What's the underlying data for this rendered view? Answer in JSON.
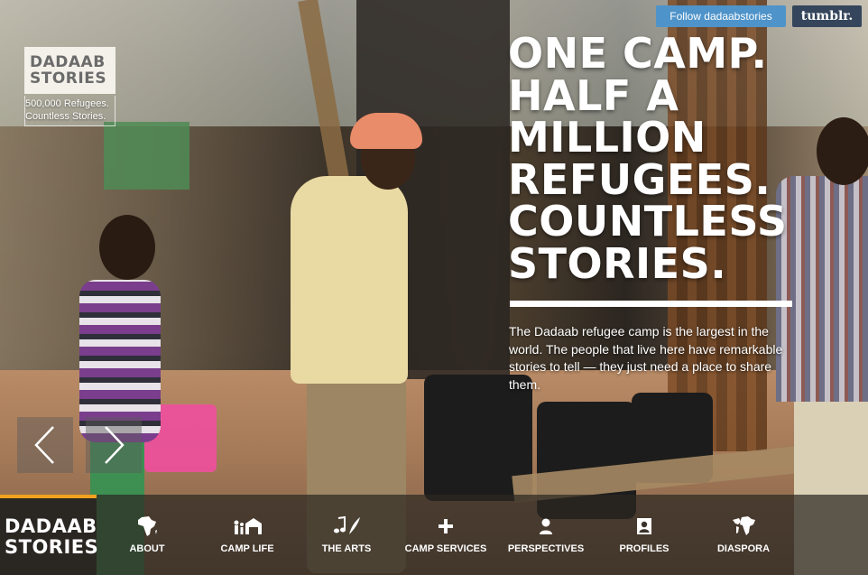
{
  "brand": {
    "logo_line1": "DADAAB",
    "logo_line2": "STORIES",
    "tagline_line1": "500,000 Refugees.",
    "tagline_line2": "Countless Stories."
  },
  "header": {
    "follow_label": "Follow dadaabstories",
    "tumblr_label": "tumblr."
  },
  "hero": {
    "headline_lines": [
      "ONE CAMP.",
      "HALF A",
      "MILLION",
      "REFUGEES.",
      "COUNTLESS",
      "STORIES."
    ],
    "intro": "The Dadaab refugee camp is the largest in the world. The people that live here have remarkable stories to tell — they just need a place to share them."
  },
  "nav": {
    "logo_line1": "DADAAB",
    "logo_line2": "STORIES",
    "items": [
      {
        "label": "ABOUT",
        "icon": "africa-map-icon"
      },
      {
        "label": "CAMP LIFE",
        "icon": "family-home-icon"
      },
      {
        "label": "THE ARTS",
        "icon": "music-quill-icon"
      },
      {
        "label": "CAMP SERVICES",
        "icon": "plus-icon"
      },
      {
        "label": "PERSPECTIVES",
        "icon": "person-icon"
      },
      {
        "label": "PROFILES",
        "icon": "portrait-icon"
      },
      {
        "label": "DIASPORA",
        "icon": "world-map-icon"
      }
    ]
  },
  "colors": {
    "accent": "#f0a21d",
    "follow": "#4e93c9",
    "tumblr": "#35465c"
  }
}
